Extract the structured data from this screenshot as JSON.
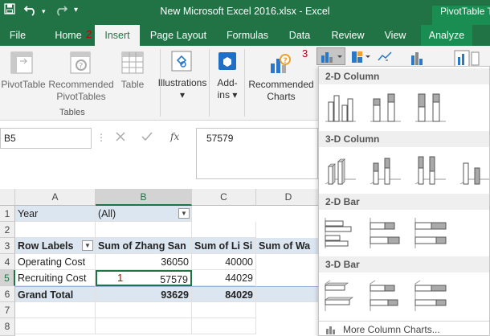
{
  "window": {
    "title": "New Microsoft Excel 2016.xlsx - Excel",
    "context_tab": "PivotTable To"
  },
  "tabs": [
    {
      "label": "File"
    },
    {
      "label": "Home"
    },
    {
      "label": "Insert"
    },
    {
      "label": "Page Layout"
    },
    {
      "label": "Formulas"
    },
    {
      "label": "Data"
    },
    {
      "label": "Review"
    },
    {
      "label": "View"
    },
    {
      "label": "Analyze"
    }
  ],
  "annotations": {
    "step1": "1",
    "step2": "2",
    "step3": "3"
  },
  "ribbon": {
    "pivottable": "PivotTable",
    "recommended_pivot_line1": "Recommended",
    "recommended_pivot_line2": "PivotTables",
    "table": "Table",
    "tables_group": "Tables",
    "illustrations": "Illustrations",
    "addins_line1": "Add-",
    "addins_line2": "ins",
    "recommended_charts_line1": "Recommended",
    "recommended_charts_line2": "Charts",
    "dropdown_arrow": "▾"
  },
  "formula_bar": {
    "name_box": "B5",
    "fx": "fx",
    "value": "57579"
  },
  "sheet": {
    "columns": [
      "A",
      "B",
      "C",
      "D"
    ],
    "rows": [
      "1",
      "2",
      "3",
      "4",
      "5",
      "6",
      "7",
      "8"
    ],
    "r1": {
      "a": "Year",
      "b": "(All)"
    },
    "r3": {
      "a": "Row Labels",
      "b": "Sum of Zhang San",
      "c": "Sum of  Li Si",
      "d": "Sum of  Wa"
    },
    "r4": {
      "a": "Operating Cost",
      "b": "36050",
      "c": "40000"
    },
    "r5": {
      "a": "Recruiting Cost",
      "b": "57579",
      "c": "44029"
    },
    "r6": {
      "a": "Grand Total",
      "b": "93629",
      "c": "84029"
    }
  },
  "gallery": {
    "section1": "2-D Column",
    "section2": "3-D Column",
    "section3": "2-D Bar",
    "section4": "3-D Bar",
    "more": "More Column Charts..."
  },
  "colors": {
    "accent": "#217346",
    "annotation_red": "#c00000",
    "pivot_band": "#dce6f1"
  }
}
